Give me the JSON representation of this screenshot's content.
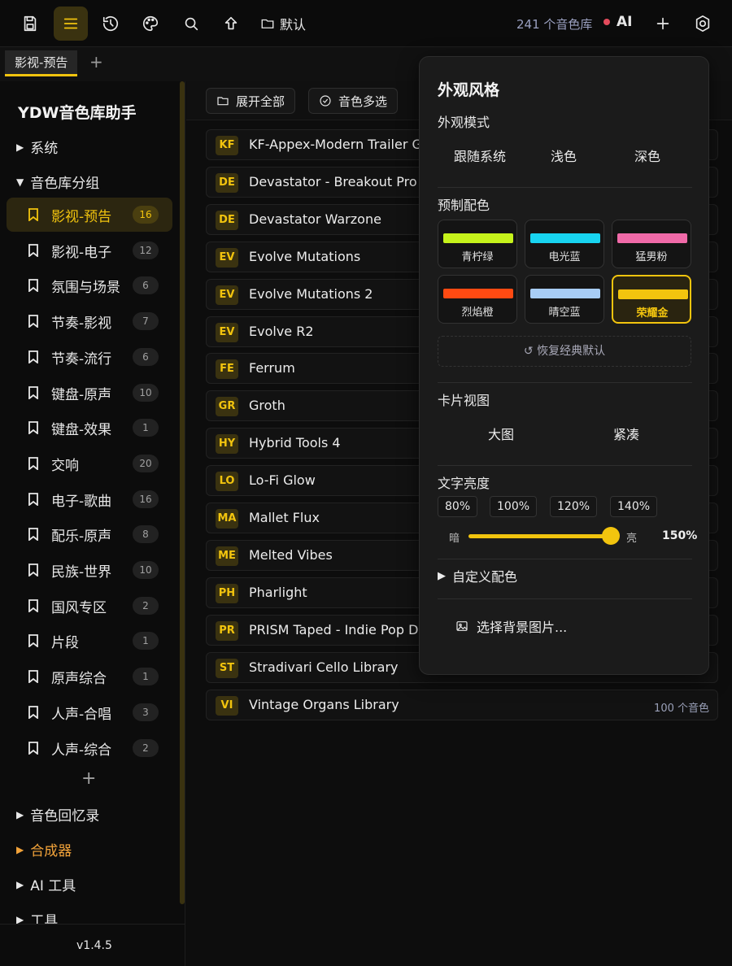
{
  "topbar": {
    "default_label": "默认",
    "library_count": "241 个音色库",
    "ai_label": "AI"
  },
  "tabs": [
    {
      "label": "影视-预告"
    }
  ],
  "sidebar": {
    "title": "YDW音色库助手",
    "sections": {
      "system": "系统",
      "groups": "音色库分组",
      "memory": "音色回忆录",
      "synth": "合成器",
      "ai_tools": "AI 工具",
      "tools": "工具"
    },
    "items": [
      {
        "label": "影视-预告",
        "count": "16"
      },
      {
        "label": "影视-电子",
        "count": "12"
      },
      {
        "label": "氛围与场景",
        "count": "6"
      },
      {
        "label": "节奏-影视",
        "count": "7"
      },
      {
        "label": "节奏-流行",
        "count": "6"
      },
      {
        "label": "键盘-原声",
        "count": "10"
      },
      {
        "label": "键盘-效果",
        "count": "1"
      },
      {
        "label": "交响",
        "count": "20"
      },
      {
        "label": "电子-歌曲",
        "count": "16"
      },
      {
        "label": "配乐-原声",
        "count": "8"
      },
      {
        "label": "民族-世界",
        "count": "10"
      },
      {
        "label": "国风专区",
        "count": "2"
      },
      {
        "label": "片段",
        "count": "1"
      },
      {
        "label": "原声综合",
        "count": "1"
      },
      {
        "label": "人声-合唱",
        "count": "3"
      },
      {
        "label": "人声-综合",
        "count": "2"
      }
    ],
    "version": "v1.4.5"
  },
  "main": {
    "expand_all": "展开全部",
    "multi_select": "音色多选",
    "libraries": [
      {
        "code": "KF",
        "name": "KF-Appex-Modern Trailer Gu",
        "count": ""
      },
      {
        "code": "DE",
        "name": "Devastator - Breakout Pro",
        "count": ""
      },
      {
        "code": "DE",
        "name": "Devastator Warzone",
        "count": ""
      },
      {
        "code": "EV",
        "name": "Evolve Mutations",
        "count": ""
      },
      {
        "code": "EV",
        "name": "Evolve Mutations 2",
        "count": ""
      },
      {
        "code": "EV",
        "name": "Evolve R2",
        "count": ""
      },
      {
        "code": "FE",
        "name": "Ferrum",
        "count": ""
      },
      {
        "code": "GR",
        "name": "Groth",
        "count": ""
      },
      {
        "code": "HY",
        "name": "Hybrid Tools 4",
        "count": ""
      },
      {
        "code": "LO",
        "name": "Lo-Fi Glow",
        "count": ""
      },
      {
        "code": "MA",
        "name": "Mallet Flux",
        "count": ""
      },
      {
        "code": "ME",
        "name": "Melted Vibes",
        "count": ""
      },
      {
        "code": "PH",
        "name": "Pharlight",
        "count": ""
      },
      {
        "code": "PR",
        "name": "PRISM Taped - Indie Pop Dru",
        "count": ""
      },
      {
        "code": "ST",
        "name": "Stradivari Cello Library",
        "count": ""
      },
      {
        "code": "VI",
        "name": "Vintage Organs Library",
        "count": "100 个音色"
      }
    ]
  },
  "panel": {
    "title": "外观风格",
    "mode_label": "外观模式",
    "modes": [
      "跟随系统",
      "浅色",
      "深色"
    ],
    "preset_label": "预制配色",
    "presets": [
      {
        "name": "青柠绿",
        "color": "#c6f31b"
      },
      {
        "name": "电光蓝",
        "color": "#18d4f0"
      },
      {
        "name": "猛男粉",
        "color": "#f06aa8"
      },
      {
        "name": "烈焰橙",
        "color": "#ff4a12"
      },
      {
        "name": "晴空蓝",
        "color": "#a8cdf5"
      },
      {
        "name": "荣耀金",
        "color": "#f2c40e",
        "selected": true
      }
    ],
    "reset": "↺ 恢复经典默认",
    "card_label": "卡片视图",
    "card_modes": [
      "大图",
      "紧凑"
    ],
    "brightness_label": "文字亮度",
    "brightness_presets": [
      "80%",
      "100%",
      "120%",
      "140%"
    ],
    "dark_label": "暗",
    "light_label": "亮",
    "brightness_value": "150%",
    "custom_label": "自定义配色",
    "bg_label": "选择背景图片..."
  },
  "colors": {
    "accent": "#f2c40e",
    "background": "#0d0d0d",
    "panel": "#1b1b1b"
  }
}
